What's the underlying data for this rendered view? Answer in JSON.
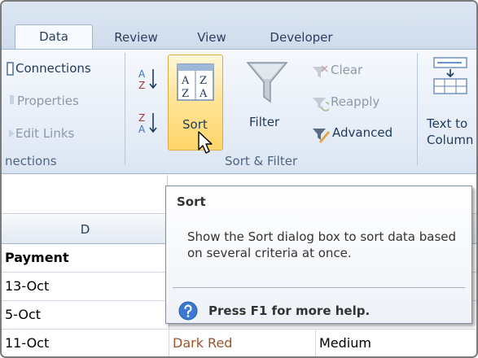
{
  "tabs": [
    "Data",
    "Review",
    "View",
    "Developer"
  ],
  "connections_group": {
    "items": [
      "Connections",
      "Properties",
      "Edit Links"
    ],
    "label": "nections"
  },
  "sort_filter_group": {
    "sort_label": "Sort",
    "filter_label": "Filter",
    "clear_label": "Clear",
    "reapply_label": "Reapply",
    "advanced_label": "Advanced",
    "label": "Sort & Filter",
    "az_glyph": [
      "A",
      "Z"
    ],
    "za_glyph": [
      "Z",
      "A"
    ],
    "sort_glyph": [
      "A",
      "Z",
      "Z",
      "A"
    ]
  },
  "data_tools": {
    "text_to_columns_label": [
      "Text to",
      "Column"
    ]
  },
  "grid": {
    "columns": [
      "D"
    ],
    "rows": [
      [
        "Payment",
        ""
      ],
      [
        "13-Oct",
        ""
      ],
      [
        "5-Oct",
        ""
      ],
      [
        "11-Oct",
        "Dark Red",
        "Medium"
      ]
    ]
  },
  "tooltip": {
    "title": "Sort",
    "description": "Show the Sort dialog box to sort data based on several criteria at once.",
    "help": "Press F1 for more help."
  },
  "colors": {
    "accent_hover": "#ffd56a",
    "ribbon": "#e7eef8",
    "help_icon": "#3a78d1",
    "dark_red_text": "#a0522d"
  }
}
